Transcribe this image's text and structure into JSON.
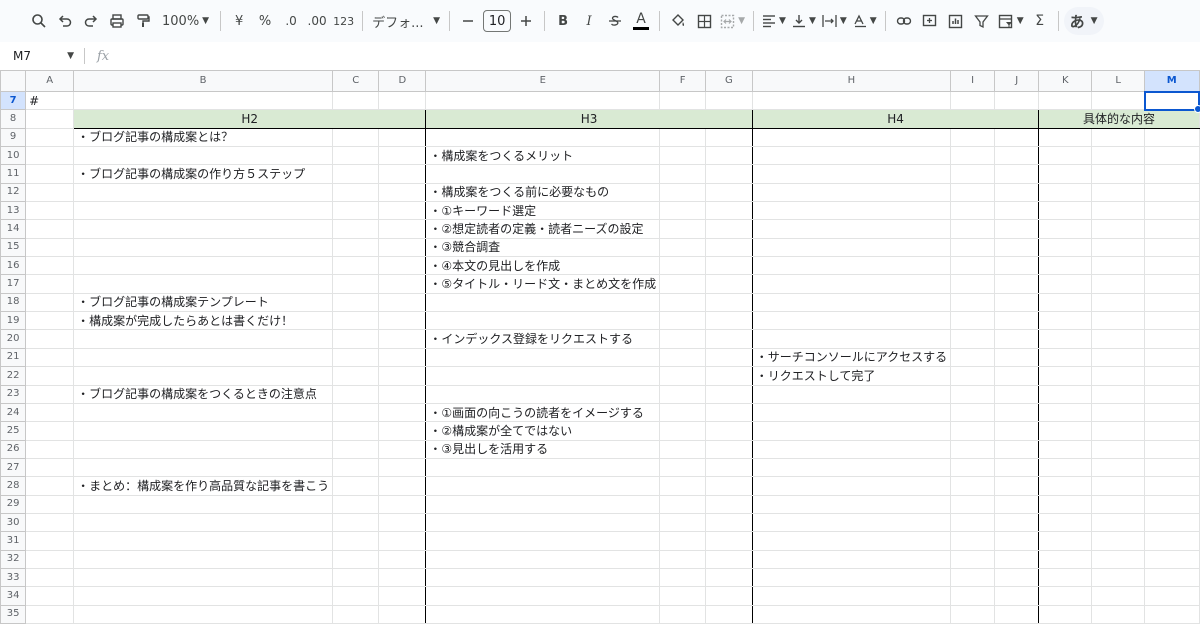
{
  "toolbar": {
    "zoom": "100%",
    "currency": "¥",
    "percent": "%",
    "dec_decrease": ".0",
    "dec_increase": ".00",
    "number_format": "123",
    "font": "デフォ...",
    "font_size": "10",
    "bold": "B",
    "italic": "I",
    "text_color": "A",
    "input_tool": "あ",
    "sigma": "Σ"
  },
  "formula_bar": {
    "cell_ref": "M7",
    "fx_label": "fx",
    "value": ""
  },
  "grid": {
    "columns": [
      "A",
      "B",
      "C",
      "D",
      "E",
      "F",
      "G",
      "H",
      "I",
      "J",
      "K",
      "L",
      "M"
    ],
    "selected_column": "M",
    "selected_row": "7",
    "rows": [
      "7",
      "8",
      "9",
      "10",
      "11",
      "12",
      "13",
      "14",
      "15",
      "16",
      "17",
      "18",
      "19",
      "20",
      "21",
      "22",
      "23",
      "24",
      "25",
      "26",
      "27",
      "28",
      "29",
      "30",
      "31",
      "32",
      "33",
      "34",
      "35"
    ],
    "cells": {
      "A7": "#",
      "H2": "H2",
      "H3": "H3",
      "H4": "H4",
      "detail": "具体的な内容",
      "B9": "・ブログ記事の構成案とは？",
      "E10": "・構成案をつくるメリット",
      "B11": "・ブログ記事の構成案の作り方５ステップ",
      "E12": "・構成案をつくる前に必要なもの",
      "E13": "・①キーワード選定",
      "E14": "・②想定読者の定義・読者ニーズの設定",
      "E15": "・③競合調査",
      "E16": "・④本文の見出しを作成",
      "E17": "・⑤タイトル・リード文・まとめ文を作成",
      "B18": "・ブログ記事の構成案テンプレート",
      "B19": "・構成案が完成したらあとは書くだけ！",
      "E20": "・インデックス登録をリクエストする",
      "H21": "・サーチコンソールにアクセスする",
      "H22": "・リクエストして完了",
      "B23": "・ブログ記事の構成案をつくるときの注意点",
      "E24": "・①画面の向こうの読者をイメージする",
      "E25": "・②構成案が全てではない",
      "E26": "・③見出しを活用する",
      "B28": "・まとめ：構成案を作り高品質な記事を書こう"
    }
  }
}
